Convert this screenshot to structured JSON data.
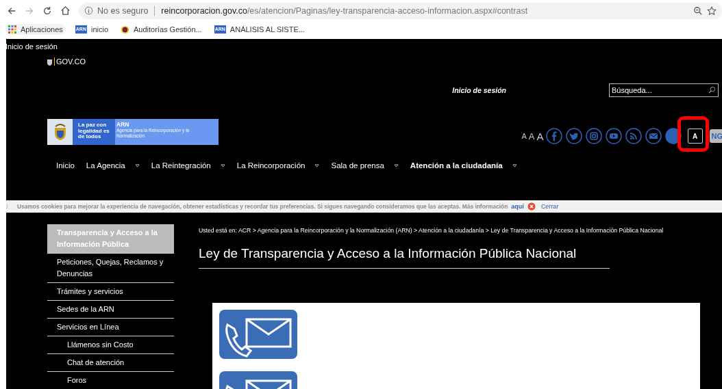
{
  "browser": {
    "security": "No es seguro",
    "url_host": "reincorporacion.gov.co",
    "url_path": "/es/atencion/Paginas/ley-transparencia-acceso-informacion.aspx#contrast",
    "bookmarks": [
      {
        "kind": "apps",
        "label": "Aplicaciones"
      },
      {
        "kind": "arn",
        "label": "inicio",
        "badge": "ARN"
      },
      {
        "kind": "circle",
        "label": "Auditorías Gestión..."
      },
      {
        "kind": "arn",
        "label": "ANÁLISIS AL SISTE...",
        "badge": "ARN"
      }
    ]
  },
  "top_link": "Inicio de sesión",
  "gov_label": "GOV.CO",
  "login_link": "Inicio de sesión",
  "search": {
    "placeholder": "Búsqueda..."
  },
  "logo": {
    "slogan": "La paz con legalidad es de todos",
    "name": "ARN",
    "subtitle": "Agencia para la Reincorporación y la Normalización"
  },
  "font_sizes": [
    "A",
    "A",
    "A"
  ],
  "social": [
    {
      "kind": "facebook"
    },
    {
      "kind": "twitter"
    },
    {
      "kind": "instagram"
    },
    {
      "kind": "youtube"
    },
    {
      "kind": "rss"
    },
    {
      "kind": "mail"
    },
    {
      "kind": "filled"
    }
  ],
  "contrast_button": "A",
  "language_button": "NG",
  "nav": [
    {
      "label": "Inicio",
      "has_submenu": false,
      "selected": false
    },
    {
      "label": "La Agencia",
      "has_submenu": true,
      "selected": false
    },
    {
      "label": "La Reintegración",
      "has_submenu": true,
      "selected": false
    },
    {
      "label": "La Reincorporación",
      "has_submenu": true,
      "selected": false
    },
    {
      "label": "Sala de prensa",
      "has_submenu": true,
      "selected": false
    },
    {
      "label": "Atención a la ciudadanía",
      "has_submenu": true,
      "selected": true
    }
  ],
  "cookie_bar": {
    "text": "Usamos cookies para mejorar la experiencia de navegación, obtener estadísticas y recordar tus preferencias. Si sigues navegando consideramos que las aceptas. Más información",
    "link": "aquí",
    "close": "Cerrar"
  },
  "sidebar": [
    {
      "label": "Transparencia y Acceso a la Información Pública",
      "selected": true
    },
    {
      "label": "Peticiones, Quejas, Reclamos y Denuncias",
      "selected": false
    },
    {
      "label": "Trámites y servicios",
      "selected": false
    },
    {
      "label": "Sedes de la ARN",
      "selected": false
    },
    {
      "label": "Servicios en Línea",
      "selected": false,
      "children": [
        {
          "label": "Llámenos sin Costo",
          "selected": false
        },
        {
          "label": "Chat de atención",
          "selected": false
        },
        {
          "label": "Foros",
          "selected": false
        }
      ]
    }
  ],
  "breadcrumb": "Usted está en: ACR > Agencia para la Reincorporación y la Normalización (ARN) > Atención a la ciudadanía > Ley de Transparencia y Acceso a la Información Pública Nacional",
  "heading": "Ley de Transparencia y Acceso a la Información Pública Nacional"
}
